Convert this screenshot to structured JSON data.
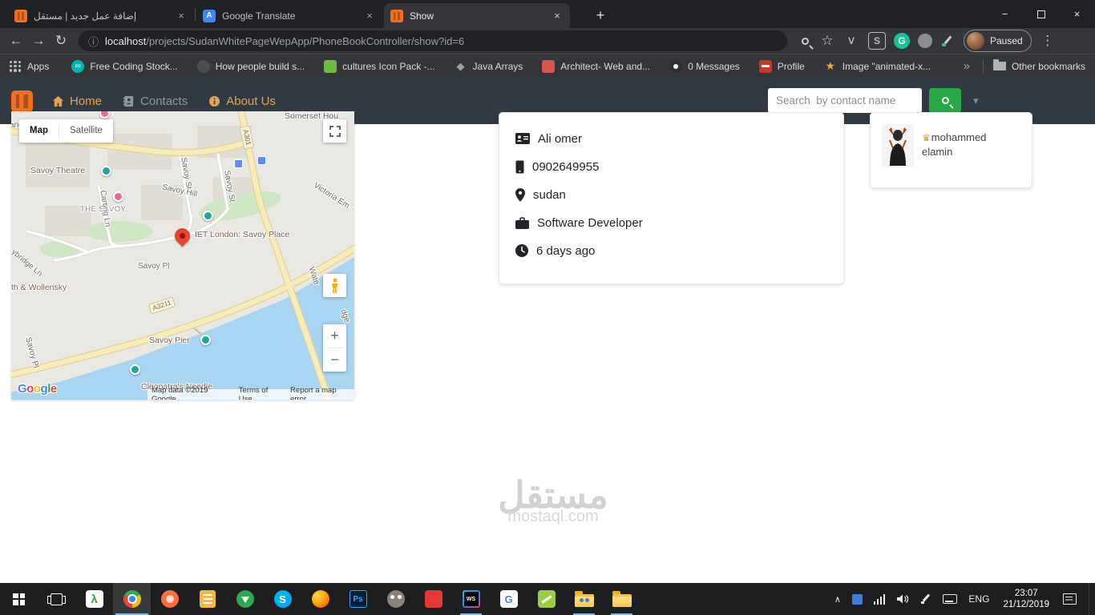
{
  "icons": {
    "back": "←",
    "forward": "→",
    "reload": "↻",
    "info": "ⓘ",
    "star": "☆",
    "menu": "⋮",
    "close": "×",
    "minimize": "−",
    "new_tab": "+",
    "caret_down": "▾",
    "chevron_up": "∧",
    "overflow": "»",
    "infinity": "∞",
    "diamond": "◆",
    "bookmark_star": "★",
    "crown": "♛",
    "ext_v": "V",
    "ext_s": "S",
    "ext_g": "G",
    "translate_a": "A",
    "zoom_in": "+",
    "zoom_out": "−",
    "lambda": "λ",
    "skype_s": "S",
    "photoshop": "Ps",
    "webstorm": "WS",
    "g_app": "G"
  },
  "browser": {
    "tabs": [
      {
        "title": "إضافة عمل جديد | مستقل"
      },
      {
        "title": "Google Translate"
      },
      {
        "title": "Show"
      }
    ],
    "url_host": "localhost",
    "url_path": "/projects/SudanWhitePageWepApp/PhoneBookController/show?id=6",
    "profile_label": "Paused",
    "bookmarks": {
      "apps": "Apps",
      "items": [
        "Free Coding Stock...",
        "How people build s...",
        "cultures Icon Pack -...",
        "Java Arrays",
        "Architect- Web and...",
        "0 Messages",
        "Profile",
        "Image \"animated-x..."
      ],
      "other": "Other bookmarks"
    }
  },
  "site": {
    "nav": {
      "home": "Home",
      "contacts": "Contacts",
      "about": "About Us",
      "search_placeholder": "Search  by contact name"
    },
    "contact": {
      "name": "Ali omer",
      "phone": "0902649955",
      "location": "sudan",
      "job": "Software Developer",
      "updated": "6 days ago"
    },
    "related": {
      "line1": "mohammed",
      "line2": "elamin"
    },
    "watermark_ar": "مستقل",
    "watermark_en": "mostaql.com"
  },
  "map": {
    "type_map": "Map",
    "type_satellite": "Satellite",
    "google_letters": [
      "G",
      "o",
      "o",
      "g",
      "l",
      "e"
    ],
    "attribution": "Map data ©2019 Google",
    "terms": "Terms of Use",
    "report": "Report a map error",
    "labels": {
      "somerset": "Somerset Hou",
      "savoy_theatre": "Savoy Theatre",
      "the_savoy": "THE SAVOY",
      "iet": "IET London: Savoy Place",
      "savoy_pier": "Savoy Pier",
      "cleopatra": "Cleopatra's Needle",
      "wollensky": "th & Wollensky",
      "victoria_em": "Victoria Em",
      "strand": "and",
      "savoy_st_1": "Savoy St",
      "savoy_st_2": "Savoy St",
      "savoy_hill": "Savoy Hill",
      "savoy_pl_1": "Savoy Pl",
      "savoy_pl_2": "Savoy Pl",
      "carting_ln": "Carting Ln",
      "ybridge_ln": "ybridge Ln",
      "wate": "Wate",
      "dge": "dge",
      "a301": "A301",
      "a3211": "A3211"
    }
  },
  "taskbar": {
    "lang": "ENG",
    "time": "23:07",
    "date": "21/12/2019"
  }
}
